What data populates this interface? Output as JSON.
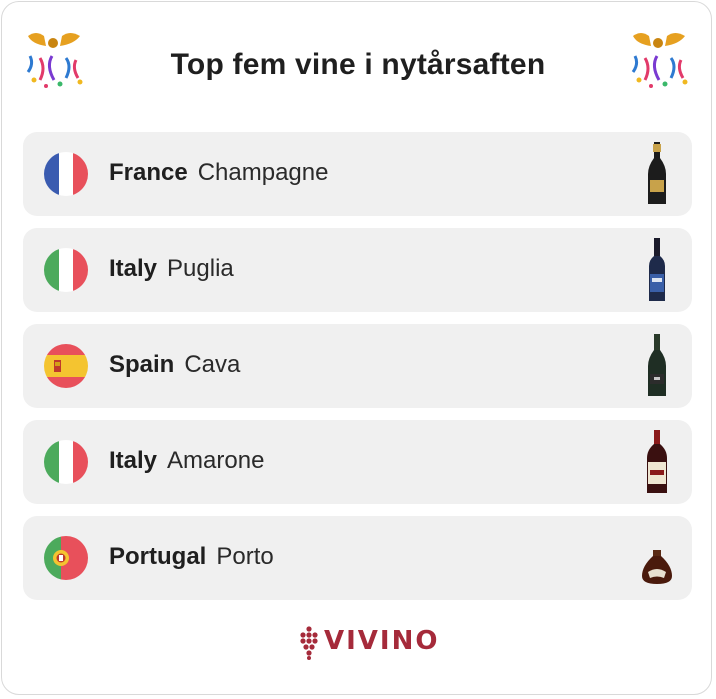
{
  "title": "Top fem vine i nytårsaften",
  "colors": {
    "row_bg": "#f0f0f0",
    "brand": "#a52a3a",
    "border": "#d9d9d9"
  },
  "rows": [
    {
      "country": "France",
      "region": "Champagne",
      "flag": "france-flag",
      "bottle": "champagne-bottle"
    },
    {
      "country": "Italy",
      "region": "Puglia",
      "flag": "italy-flag",
      "bottle": "red-wine-bottle"
    },
    {
      "country": "Spain",
      "region": "Cava",
      "flag": "spain-flag",
      "bottle": "cava-bottle"
    },
    {
      "country": "Italy",
      "region": "Amarone",
      "flag": "italy-flag",
      "bottle": "amarone-bottle"
    },
    {
      "country": "Portugal",
      "region": "Porto",
      "flag": "portugal-flag",
      "bottle": "port-decanter"
    }
  ],
  "brand": {
    "name": "vivino",
    "logo_text": "VIVINO"
  }
}
